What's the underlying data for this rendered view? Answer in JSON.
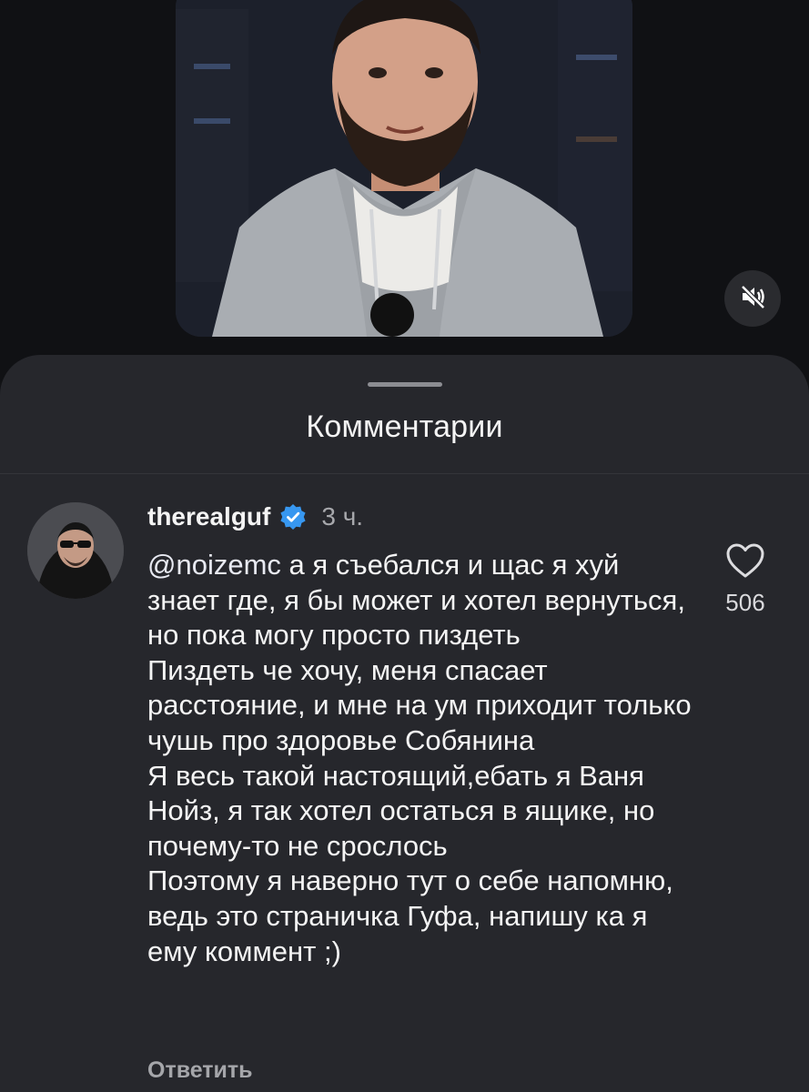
{
  "sheet": {
    "title": "Комментарии"
  },
  "comment": {
    "username": "therealguf",
    "time": "3 ч.",
    "mention": "@noizemc",
    "text": " а я съебался и щас я хуй знает где, я бы может и хотел вернуться, но пока могу просто пиздеть\nПиздеть че хочу, меня спасает расстояние, и мне на ум приходит только чушь про здоровье Собянина\nЯ весь такой настоящий,ебать я Ваня  Нойз, я так хотел остаться в ящике, но почему-то не срослось\nПоэтому я наверно тут о себе напомню, ведь это страничка Гуфа, напишу ка я ему коммент ;)",
    "like_count": "506",
    "reply_label": "Ответить"
  },
  "icons": {
    "mute": "muted-speaker-icon",
    "verified": "verified-badge-icon",
    "like": "heart-outline-icon"
  },
  "colors": {
    "sheet_background": "#26272c",
    "verified_blue": "#3797f0",
    "secondary_text": "#a7a8ac"
  }
}
